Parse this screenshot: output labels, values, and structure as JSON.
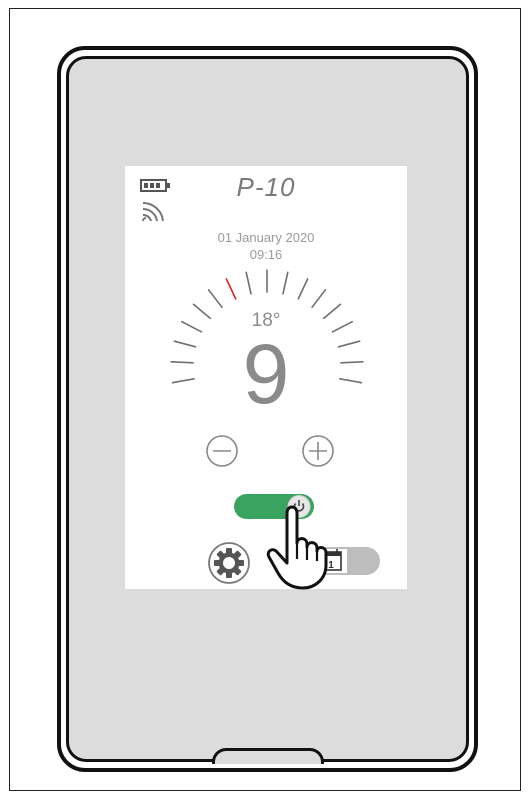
{
  "device": {
    "title": "P-10",
    "date": "01 January 2020",
    "time": "09:16",
    "setpoint_temp": "18°",
    "current_temp": "9"
  },
  "status_icons": [
    "battery-icon",
    "wifi-signal-icon"
  ],
  "controls": {
    "decrease_icon": "minus-circle-icon",
    "increase_icon": "plus-circle-icon",
    "power_toggle_state": "on",
    "schedule_toggle_state": "off",
    "schedule_day": "1"
  },
  "colors": {
    "power_on": "#3aa35f",
    "dial_marker": "#e0241b",
    "text_gray": "#8a8a8a"
  }
}
